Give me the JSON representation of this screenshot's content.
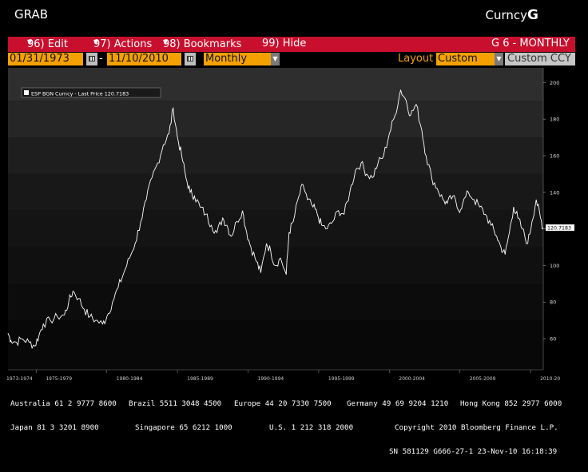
{
  "header": {
    "left_title": "GRAB",
    "right_title": "Curncy",
    "right_title_suffix": "G"
  },
  "menu": {
    "edit": "96) Edit",
    "actions": "97) Actions",
    "bookmarks": "98) Bookmarks",
    "hide": "99) Hide",
    "right": "G 6 - MONTHLY"
  },
  "controls": {
    "start_date": "01/31/1973",
    "dash": "-",
    "end_date": "11/10/2010",
    "period": "Monthly",
    "layout_label": "Layout",
    "layout_value": "Custom",
    "custom_ccy": "Custom CCY"
  },
  "colors": {
    "menu_red": "#c8102e",
    "field_orange": "#f4a100",
    "panel": "#1c1c1c"
  },
  "chart_data": {
    "type": "line",
    "legend": "ESP BGN Curncy - Last Price 120.7183",
    "last_price_label": "120.7183",
    "last_price": 120.7183,
    "ylim": [
      43,
      208
    ],
    "y_ticks": [
      "60",
      "80",
      "100",
      "120",
      "140",
      "160",
      "180",
      "200"
    ],
    "x_tick_labels": [
      "1973-1974",
      "1975-1979",
      "1980-1984",
      "1985-1989",
      "1990-1994",
      "1995-1999",
      "2000-2004",
      "2005-2009",
      "2010-20"
    ],
    "x_range": [
      1973.0,
      2010.9
    ],
    "series": [
      {
        "values": [
          [
            1973.0,
            63
          ],
          [
            1973.2,
            59
          ],
          [
            1973.6,
            58
          ],
          [
            1974.0,
            60
          ],
          [
            1974.5,
            58
          ],
          [
            1974.9,
            56
          ],
          [
            1975.2,
            62
          ],
          [
            1975.5,
            68
          ],
          [
            1976.0,
            70
          ],
          [
            1976.5,
            72
          ],
          [
            1977.0,
            73
          ],
          [
            1977.3,
            80
          ],
          [
            1977.6,
            86
          ],
          [
            1978.0,
            82
          ],
          [
            1978.4,
            76
          ],
          [
            1978.8,
            72
          ],
          [
            1979.2,
            70
          ],
          [
            1979.7,
            68
          ],
          [
            1980.0,
            72
          ],
          [
            1980.4,
            80
          ],
          [
            1980.8,
            88
          ],
          [
            1981.2,
            96
          ],
          [
            1981.6,
            104
          ],
          [
            1982.0,
            112
          ],
          [
            1982.4,
            124
          ],
          [
            1982.8,
            136
          ],
          [
            1983.2,
            148
          ],
          [
            1983.6,
            156
          ],
          [
            1984.0,
            166
          ],
          [
            1984.4,
            172
          ],
          [
            1984.7,
            186
          ],
          [
            1985.0,
            170
          ],
          [
            1985.3,
            160
          ],
          [
            1985.6,
            148
          ],
          [
            1985.9,
            140
          ],
          [
            1986.2,
            138
          ],
          [
            1986.6,
            132
          ],
          [
            1987.0,
            128
          ],
          [
            1987.4,
            122
          ],
          [
            1987.8,
            118
          ],
          [
            1988.2,
            126
          ],
          [
            1988.5,
            122
          ],
          [
            1988.8,
            116
          ],
          [
            1989.2,
            124
          ],
          [
            1989.6,
            130
          ],
          [
            1989.9,
            118
          ],
          [
            1990.2,
            110
          ],
          [
            1990.6,
            102
          ],
          [
            1990.9,
            96
          ],
          [
            1991.3,
            112
          ],
          [
            1991.6,
            108
          ],
          [
            1991.9,
            100
          ],
          [
            1992.3,
            104
          ],
          [
            1992.7,
            95
          ],
          [
            1992.9,
            118
          ],
          [
            1993.2,
            124
          ],
          [
            1993.6,
            138
          ],
          [
            1993.9,
            144
          ],
          [
            1994.2,
            136
          ],
          [
            1994.6,
            132
          ],
          [
            1994.9,
            128
          ],
          [
            1995.2,
            122
          ],
          [
            1995.6,
            120
          ],
          [
            1996.0,
            124
          ],
          [
            1996.4,
            130
          ],
          [
            1996.8,
            128
          ],
          [
            1997.2,
            140
          ],
          [
            1997.6,
            152
          ],
          [
            1998.0,
            156
          ],
          [
            1998.4,
            150
          ],
          [
            1998.8,
            148
          ],
          [
            1999.2,
            156
          ],
          [
            1999.6,
            160
          ],
          [
            2000.0,
            172
          ],
          [
            2000.4,
            182
          ],
          [
            2000.8,
            196
          ],
          [
            2001.2,
            190
          ],
          [
            2001.5,
            182
          ],
          [
            2001.9,
            188
          ],
          [
            2002.3,
            174
          ],
          [
            2002.6,
            160
          ],
          [
            2003.0,
            148
          ],
          [
            2003.4,
            142
          ],
          [
            2003.8,
            136
          ],
          [
            2004.1,
            134
          ],
          [
            2004.5,
            138
          ],
          [
            2004.9,
            130
          ],
          [
            2005.2,
            134
          ],
          [
            2005.6,
            140
          ],
          [
            2006.0,
            136
          ],
          [
            2006.4,
            132
          ],
          [
            2006.8,
            128
          ],
          [
            2007.2,
            122
          ],
          [
            2007.6,
            116
          ],
          [
            2007.9,
            110
          ],
          [
            2008.2,
            106
          ],
          [
            2008.5,
            118
          ],
          [
            2008.8,
            132
          ],
          [
            2009.1,
            126
          ],
          [
            2009.4,
            120
          ],
          [
            2009.8,
            112
          ],
          [
            2010.1,
            124
          ],
          [
            2010.4,
            136
          ],
          [
            2010.7,
            126
          ],
          [
            2010.86,
            120.7
          ]
        ]
      }
    ]
  },
  "footer": {
    "l1a": "Australia 61 2 9777 8600",
    "l1b": "Brazil 5511 3048 4500",
    "l1c": "Europe 44 20 7330 7500",
    "l1d": "Germany 49 69 9204 1210",
    "l1e": "Hong Kong 852 2977 6000",
    "l2a": "Japan 81 3 3201 8900",
    "l2b": "Singapore 65 6212 1000",
    "l2c": "U.S. 1 212 318 2000",
    "l2d": "Copyright 2010 Bloomberg Finance L.P.",
    "l3": "SN 581129 G666-27-1 23-Nov-10 16:18:39"
  }
}
